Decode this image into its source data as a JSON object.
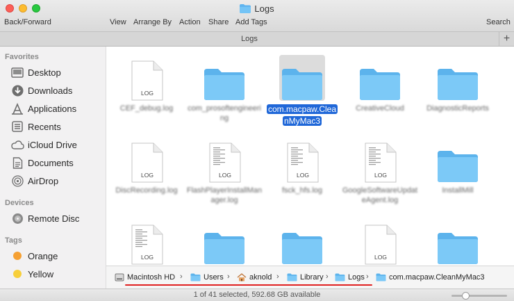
{
  "window": {
    "title": "Logs"
  },
  "toolbar": {
    "back_forward": "Back/Forward",
    "view": "View",
    "arrange_by": "Arrange By",
    "action": "Action",
    "share": "Share",
    "add_tags": "Add Tags",
    "search": "Search"
  },
  "tab": {
    "label": "Logs",
    "add": "+"
  },
  "sidebar": {
    "favorites_header": "Favorites",
    "favorites": [
      {
        "label": "Desktop",
        "icon": "desktop-icon"
      },
      {
        "label": "Downloads",
        "icon": "downloads-icon"
      },
      {
        "label": "Applications",
        "icon": "applications-icon"
      },
      {
        "label": "Recents",
        "icon": "recents-icon"
      },
      {
        "label": "iCloud Drive",
        "icon": "icloud-icon"
      },
      {
        "label": "Documents",
        "icon": "documents-icon"
      },
      {
        "label": "AirDrop",
        "icon": "airdrop-icon"
      }
    ],
    "devices_header": "Devices",
    "devices": [
      {
        "label": "Remote Disc",
        "icon": "remote-disc-icon"
      }
    ],
    "tags_header": "Tags",
    "tags": [
      {
        "label": "Orange",
        "color": "#f5a033"
      },
      {
        "label": "Yellow",
        "color": "#f7cf3b"
      }
    ]
  },
  "files": [
    {
      "name": "CEF_debug.log",
      "kind": "log",
      "selected": false
    },
    {
      "name": "com_prosoftengineering",
      "kind": "folder",
      "selected": false
    },
    {
      "name": "com.macpaw.CleanMyMac3",
      "kind": "folder",
      "selected": true
    },
    {
      "name": "CreativeCloud",
      "kind": "folder",
      "selected": false
    },
    {
      "name": "DiagnosticReports",
      "kind": "folder",
      "selected": false
    },
    {
      "name": "DiscRecording.log",
      "kind": "log",
      "selected": false
    },
    {
      "name": "FlashPlayerInstallManager.log",
      "kind": "log-text",
      "selected": false
    },
    {
      "name": "fsck_hfs.log",
      "kind": "log-text",
      "selected": false
    },
    {
      "name": "GoogleSoftwareUpdateAgent.log",
      "kind": "log-text",
      "selected": false
    },
    {
      "name": "InstallMill",
      "kind": "folder",
      "selected": false
    },
    {
      "name": "",
      "kind": "log-text",
      "selected": false
    },
    {
      "name": "",
      "kind": "folder",
      "selected": false
    },
    {
      "name": "",
      "kind": "folder",
      "selected": false
    },
    {
      "name": "",
      "kind": "log",
      "selected": false
    },
    {
      "name": "",
      "kind": "folder",
      "selected": false
    }
  ],
  "selected_label_lines": [
    "com.macpaw.Clea",
    "nMyMac3"
  ],
  "file_badge": "LOG",
  "pathbar": {
    "crumbs": [
      {
        "label": "Macintosh HD",
        "icon": "hard-drive-icon"
      },
      {
        "label": "Users",
        "icon": "folder-icon"
      },
      {
        "label": "aknold",
        "icon": "home-icon"
      },
      {
        "label": "Library",
        "icon": "folder-icon"
      },
      {
        "label": "Logs",
        "icon": "folder-icon"
      },
      {
        "label": "com.macpaw.CleanMyMac3",
        "icon": "folder-icon"
      }
    ],
    "separator": "›"
  },
  "status": {
    "text": "1 of 41 selected, 592.68 GB available",
    "icon_size_level": 0.25
  },
  "colors": {
    "accent": "#1f67d8",
    "folder": "#6cc0f3",
    "highlight_line": "#e02020"
  }
}
